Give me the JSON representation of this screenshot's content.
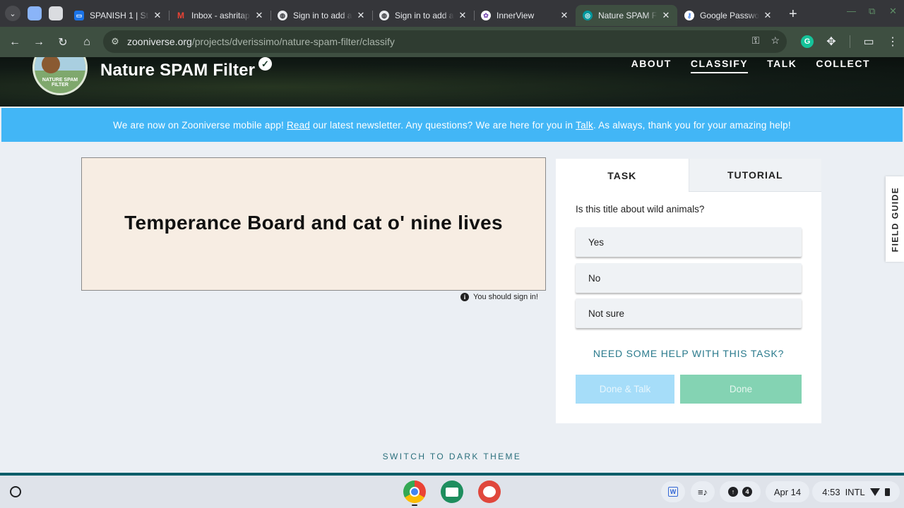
{
  "browser": {
    "tabs": [
      {
        "title": "SPANISH 1 | St",
        "favicon_color": "#1a73e8",
        "active": false
      },
      {
        "title": "Inbox - ashritap",
        "favicon_color": "#ea4335",
        "active": false
      },
      {
        "title": "Sign in to add a",
        "favicon_color": "#e8eaed",
        "active": false
      },
      {
        "title": "Sign in to add a",
        "favicon_color": "#e8eaed",
        "active": false
      },
      {
        "title": "InnerView",
        "favicon_color": "#b38bd9",
        "active": false
      },
      {
        "title": "Nature SPAM Fi",
        "favicon_color": "#00979d",
        "active": true
      },
      {
        "title": "Google Passwo",
        "favicon_color": "#4285f4",
        "active": false
      }
    ],
    "url_host": "zooniverse.org",
    "url_path": "/projects/dverissimo/nature-spam-filter/classify"
  },
  "header": {
    "project_title": "Nature SPAM Filter",
    "avatar_caption": "NATURE SPAM FILTER",
    "nav": [
      {
        "label": "ABOUT",
        "current": false
      },
      {
        "label": "CLASSIFY",
        "current": true
      },
      {
        "label": "TALK",
        "current": false
      },
      {
        "label": "COLLECT",
        "current": false
      }
    ]
  },
  "announcement": {
    "part1": "We are now on Zooniverse mobile app! ",
    "link1": "Read",
    "part2": " our latest newsletter. Any questions? We are here for you in ",
    "link2": "Talk",
    "part3": ". As always, thank you for your amazing help!"
  },
  "subject": {
    "text": "Temperance Board and cat o' nine lives",
    "signin_note": "You should sign in!"
  },
  "task": {
    "tab_task": "TASK",
    "tab_tutorial": "TUTORIAL",
    "question": "Is this title about wild animals?",
    "answers": [
      "Yes",
      "No",
      "Not sure"
    ],
    "help_link": "NEED SOME HELP WITH THIS TASK?",
    "done_talk": "Done & Talk",
    "done": "Done"
  },
  "field_guide": "FIELD GUIDE",
  "theme_toggle": "SWITCH TO DARK THEME",
  "shelf": {
    "notification_count": "4",
    "date": "Apr 14",
    "time": "4:53",
    "ime": "INTL"
  },
  "colors": {
    "announcement_bg": "#42b6f6",
    "done_bg": "#84d3b3",
    "done_talk_bg": "#a6ddf9",
    "help_link": "#2a7a8c"
  }
}
